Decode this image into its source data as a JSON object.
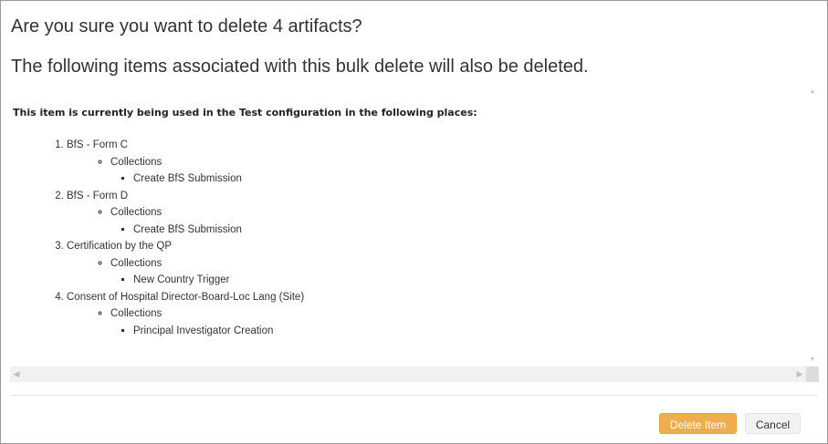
{
  "dialog": {
    "title": "Are you sure you want to delete 4 artifacts?",
    "subtitle": "The following items associated with this bulk delete will also be deleted."
  },
  "usage": {
    "intro_prefix": "This item is currently being used in the ",
    "configuration": "Test",
    "intro_suffix": " configuration in the following places:",
    "items": [
      {
        "name": "BfS - Form C",
        "group": "Collections",
        "entry": "Create BfS Submission"
      },
      {
        "name": "BfS - Form D",
        "group": "Collections",
        "entry": "Create BfS Submission"
      },
      {
        "name": "Certification by the QP",
        "group": "Collections",
        "entry": "New Country Trigger"
      },
      {
        "name": "Consent of Hospital Director-Board-Loc Lang (Site)",
        "group": "Collections",
        "entry": "Principal Investigator Creation"
      }
    ]
  },
  "scrollbars": {
    "up_icon": "▲",
    "down_icon": "▼",
    "left_icon": "◀",
    "right_icon": "▶"
  },
  "footer": {
    "delete_label": "Delete Item",
    "cancel_label": "Cancel"
  },
  "colors": {
    "delete_button": "#f0ad4e",
    "cancel_button": "#f2f2f2"
  }
}
